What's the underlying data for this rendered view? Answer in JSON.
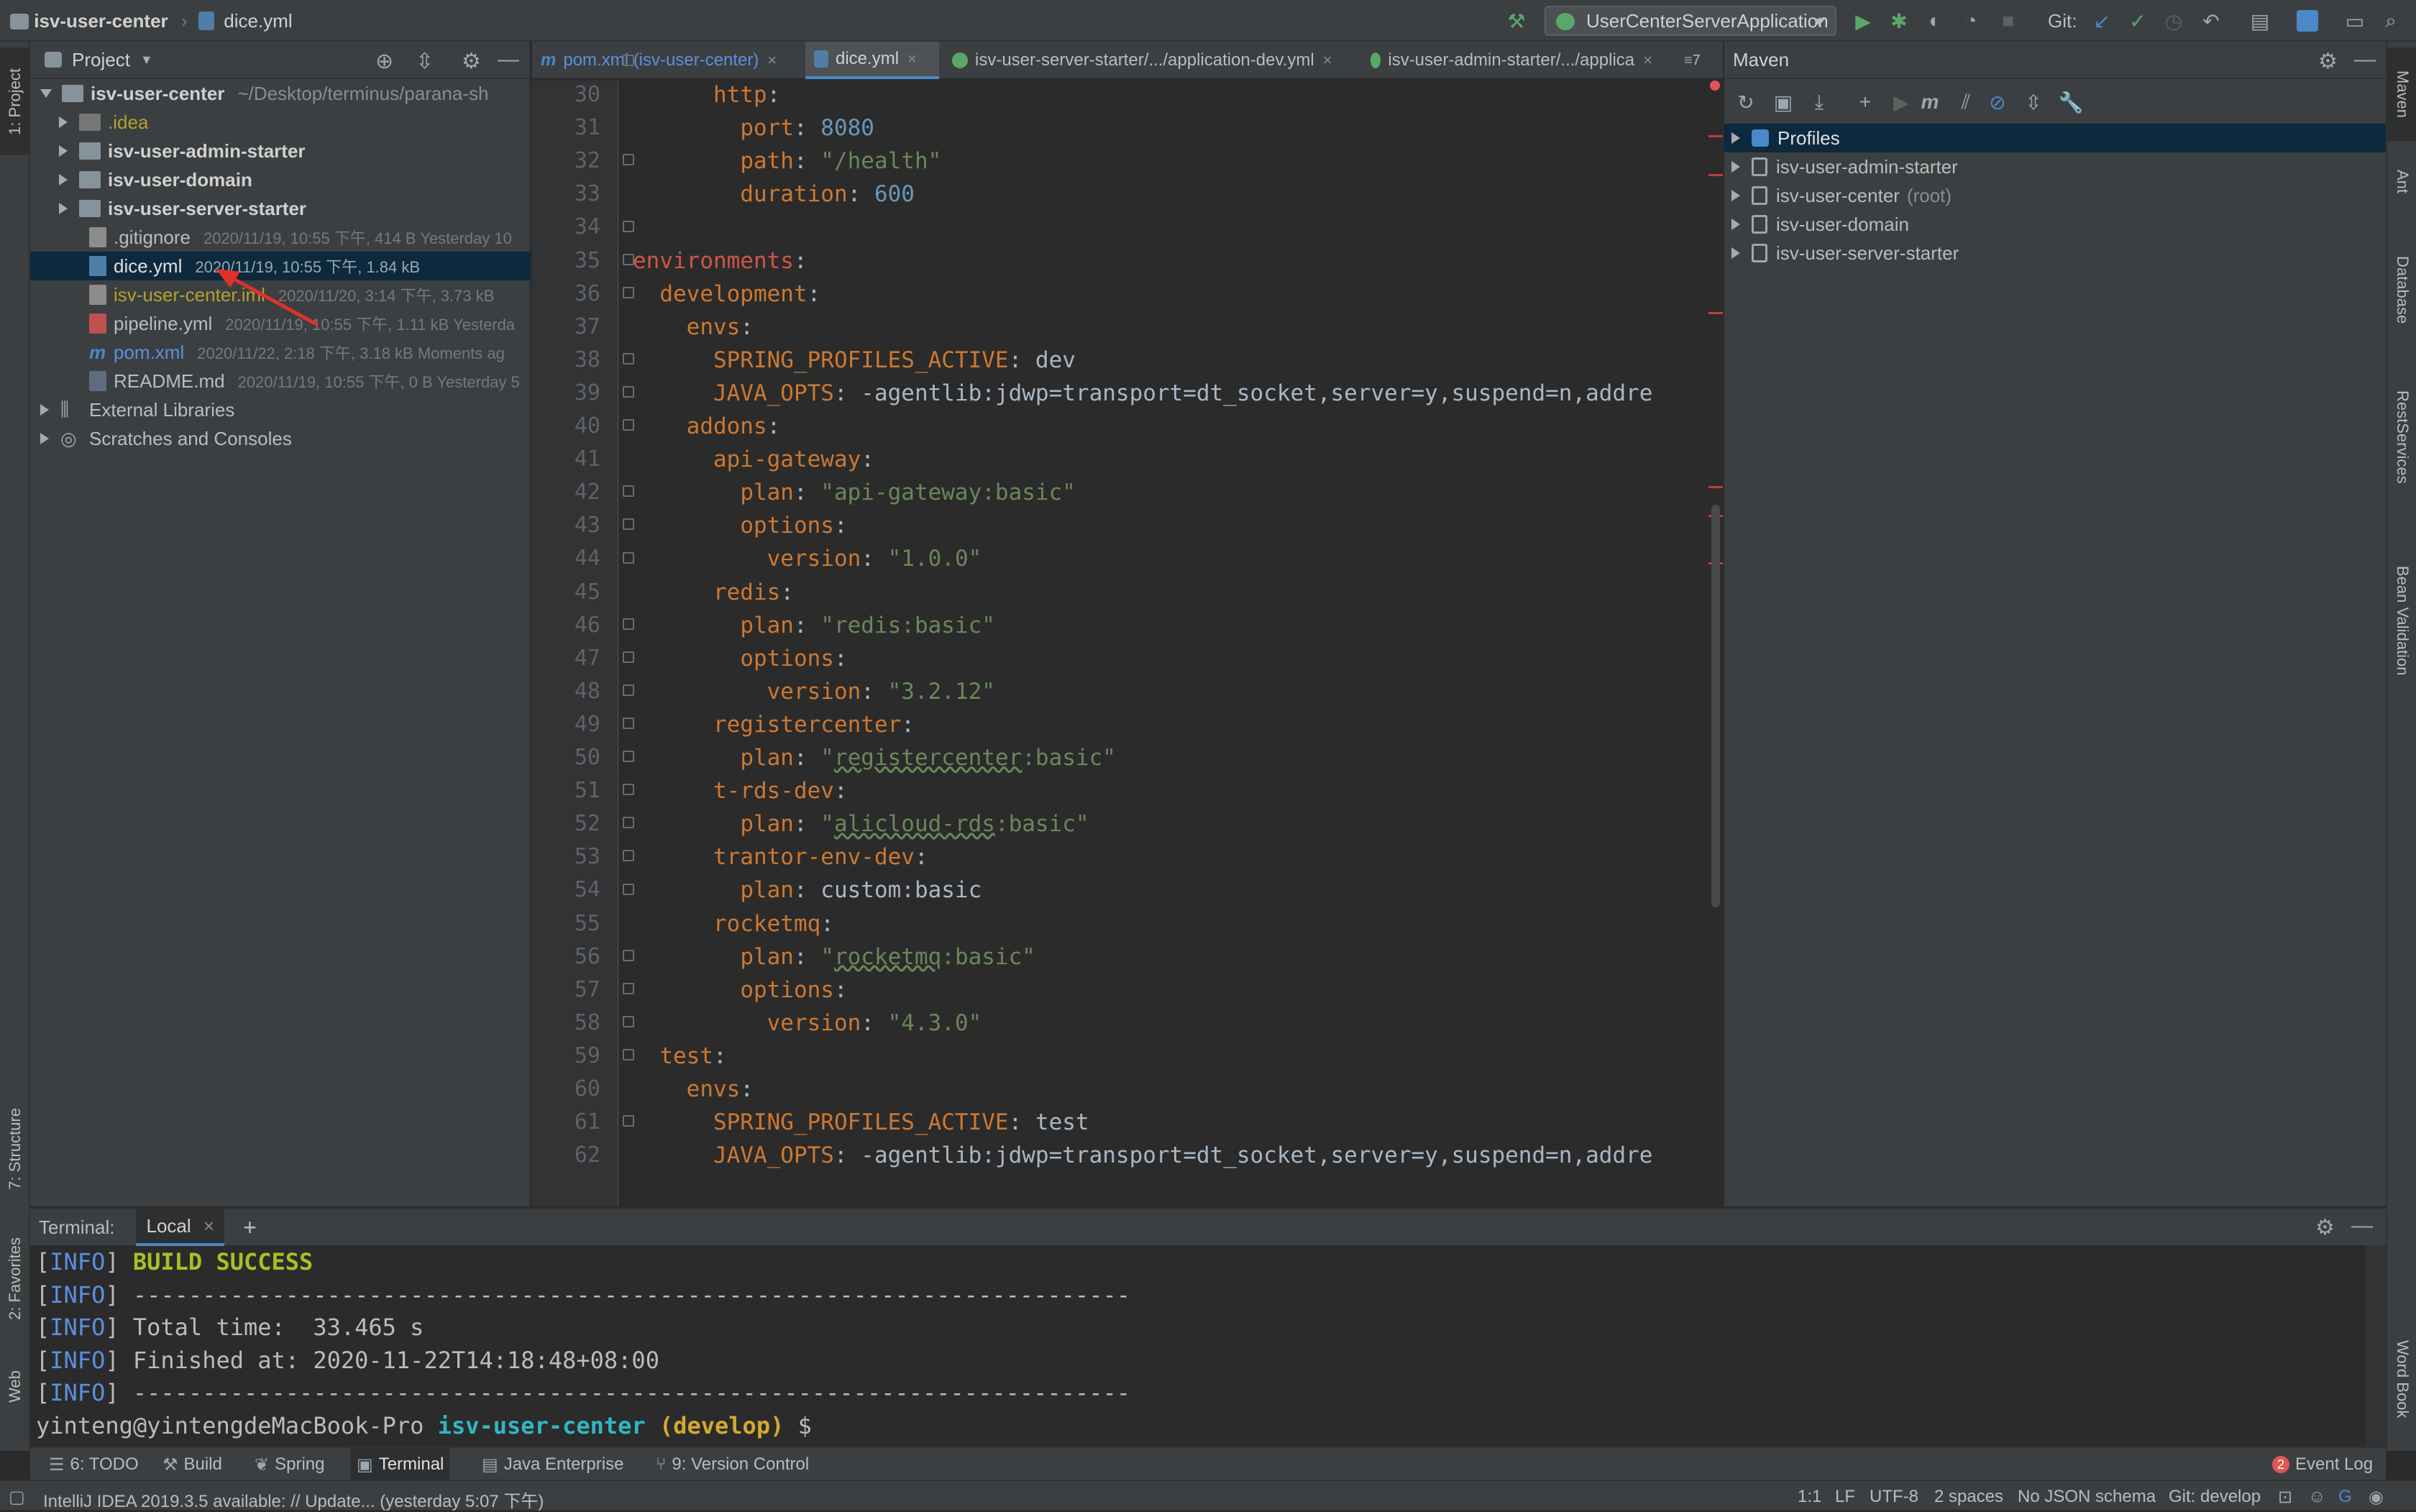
{
  "nav": {
    "project": "isv-user-center",
    "file": "dice.yml",
    "run_config": "UserCenterServerApplication",
    "git_label": "Git:"
  },
  "colors": {
    "accent": "#4a88c7",
    "selection": "#0d293e",
    "build_success": "#a8c023",
    "info": "#5c8fe0",
    "error_badge": "#e05555"
  },
  "left_stripe": {
    "project": "1: Project",
    "structure": "7: Structure",
    "favorites": "2: Favorites",
    "web": "Web"
  },
  "right_stripe": {
    "maven": "Maven",
    "ant": "Ant",
    "database": "Database",
    "rest": "RestServices",
    "bean": "Bean Validation",
    "word": "Word Book"
  },
  "project_panel": {
    "title": "Project",
    "root_name": "isv-user-center",
    "root_path": "~/Desktop/terminus/parana-sh",
    "items": [
      {
        "name": ".idea",
        "meta": ""
      },
      {
        "name": "isv-user-admin-starter",
        "meta": ""
      },
      {
        "name": "isv-user-domain",
        "meta": ""
      },
      {
        "name": "isv-user-server-starter",
        "meta": ""
      },
      {
        "name": ".gitignore",
        "meta": "2020/11/19, 10:55 下午, 414 B Yesterday 10"
      },
      {
        "name": "dice.yml",
        "meta": "2020/11/19, 10:55 下午, 1.84 kB"
      },
      {
        "name": "isv-user-center.iml",
        "meta": "2020/11/20, 3:14 下午, 3.73 kB"
      },
      {
        "name": "pipeline.yml",
        "meta": "2020/11/19, 10:55 下午, 1.11 kB Yesterda"
      },
      {
        "name": "pom.xml",
        "meta": "2020/11/22, 2:18 下午, 3.18 kB Moments ag"
      },
      {
        "name": "README.md",
        "meta": "2020/11/19, 10:55 下午, 0 B Yesterday 5"
      }
    ],
    "external": "External Libraries",
    "scratches": "Scratches and Consoles"
  },
  "editor": {
    "tabs": [
      {
        "label": "pom.xml (isv-user-center)"
      },
      {
        "label": "dice.yml"
      },
      {
        "label": "isv-user-server-starter/.../application-dev.yml"
      },
      {
        "label": "isv-user-admin-starter/.../applica"
      }
    ],
    "tab_overflow": "7",
    "line_numbers": [
      "30",
      "31",
      "32",
      "33",
      "34",
      "35",
      "36",
      "37",
      "38",
      "39",
      "40",
      "41",
      "42",
      "43",
      "44",
      "45",
      "46",
      "47",
      "48",
      "49",
      "50",
      "51",
      "52",
      "53",
      "54",
      "55",
      "56",
      "57",
      "58",
      "59",
      "60",
      "61",
      "62"
    ],
    "lines": [
      {
        "indent": "      ",
        "key": "http",
        "sep": ":",
        "val": "",
        "vtype": ""
      },
      {
        "indent": "        ",
        "key": "port",
        "sep": ": ",
        "val": "8080",
        "vtype": "n"
      },
      {
        "indent": "        ",
        "key": "path",
        "sep": ": ",
        "val": "\"/health\"",
        "vtype": "s"
      },
      {
        "indent": "        ",
        "key": "duration",
        "sep": ": ",
        "val": "600",
        "vtype": "n"
      },
      {
        "indent": "",
        "key": "",
        "sep": "",
        "val": "",
        "vtype": ""
      },
      {
        "indent": "",
        "key": "environments",
        "sep": ":",
        "val": "",
        "vtype": "",
        "ktype": "r"
      },
      {
        "indent": "  ",
        "key": "development",
        "sep": ":",
        "val": "",
        "vtype": ""
      },
      {
        "indent": "    ",
        "key": "envs",
        "sep": ":",
        "val": "",
        "vtype": ""
      },
      {
        "indent": "      ",
        "key": "SPRING_PROFILES_ACTIVE",
        "sep": ": ",
        "val": "dev",
        "vtype": "v"
      },
      {
        "indent": "      ",
        "key": "JAVA_OPTS",
        "sep": ": ",
        "val": "-agentlib:jdwp=transport=dt_socket,server=y,suspend=n,addre",
        "vtype": "v"
      },
      {
        "indent": "    ",
        "key": "addons",
        "sep": ":",
        "val": "",
        "vtype": ""
      },
      {
        "indent": "      ",
        "key": "api-gateway",
        "sep": ":",
        "val": "",
        "vtype": ""
      },
      {
        "indent": "        ",
        "key": "plan",
        "sep": ": ",
        "val": "\"api-gateway:basic\"",
        "vtype": "s"
      },
      {
        "indent": "        ",
        "key": "options",
        "sep": ":",
        "val": "",
        "vtype": ""
      },
      {
        "indent": "          ",
        "key": "version",
        "sep": ": ",
        "val": "\"1.0.0\"",
        "vtype": "s"
      },
      {
        "indent": "      ",
        "key": "redis",
        "sep": ":",
        "val": "",
        "vtype": ""
      },
      {
        "indent": "        ",
        "key": "plan",
        "sep": ": ",
        "val": "\"redis:basic\"",
        "vtype": "s"
      },
      {
        "indent": "        ",
        "key": "options",
        "sep": ":",
        "val": "",
        "vtype": ""
      },
      {
        "indent": "          ",
        "key": "version",
        "sep": ": ",
        "val": "\"3.2.12\"",
        "vtype": "s"
      },
      {
        "indent": "      ",
        "key": "registercenter",
        "sep": ":",
        "val": "",
        "vtype": ""
      },
      {
        "indent": "        ",
        "key": "plan",
        "sep": ": ",
        "val": "\"registercenter:basic\"",
        "vtype": "s"
      },
      {
        "indent": "      ",
        "key": "t-rds-dev",
        "sep": ":",
        "val": "",
        "vtype": ""
      },
      {
        "indent": "        ",
        "key": "plan",
        "sep": ": ",
        "val": "\"alicloud-rds:basic\"",
        "vtype": "s"
      },
      {
        "indent": "      ",
        "key": "trantor-env-dev",
        "sep": ":",
        "val": "",
        "vtype": ""
      },
      {
        "indent": "        ",
        "key": "plan",
        "sep": ": ",
        "val": "custom:basic",
        "vtype": "v"
      },
      {
        "indent": "      ",
        "key": "rocketmq",
        "sep": ":",
        "val": "",
        "vtype": ""
      },
      {
        "indent": "        ",
        "key": "plan",
        "sep": ": ",
        "val": "\"rocketmq:basic\"",
        "vtype": "s"
      },
      {
        "indent": "        ",
        "key": "options",
        "sep": ":",
        "val": "",
        "vtype": ""
      },
      {
        "indent": "          ",
        "key": "version",
        "sep": ": ",
        "val": "\"4.3.0\"",
        "vtype": "s"
      },
      {
        "indent": "  ",
        "key": "test",
        "sep": ":",
        "val": "",
        "vtype": ""
      },
      {
        "indent": "    ",
        "key": "envs",
        "sep": ":",
        "val": "",
        "vtype": ""
      },
      {
        "indent": "      ",
        "key": "SPRING_PROFILES_ACTIVE",
        "sep": ": ",
        "val": "test",
        "vtype": "v"
      },
      {
        "indent": "      ",
        "key": "JAVA_OPTS",
        "sep": ": ",
        "val": "-agentlib:jdwp=transport=dt_socket,server=y,suspend=n,addre",
        "vtype": "v"
      }
    ]
  },
  "maven": {
    "title": "Maven",
    "items": [
      {
        "name": "Profiles",
        "suffix": ""
      },
      {
        "name": "isv-user-admin-starter",
        "suffix": ""
      },
      {
        "name": "isv-user-center",
        "suffix": "(root)"
      },
      {
        "name": "isv-user-domain",
        "suffix": ""
      },
      {
        "name": "isv-user-server-starter",
        "suffix": ""
      }
    ]
  },
  "terminal": {
    "title": "Terminal:",
    "tab": "Local",
    "lines": [
      {
        "tag": "[INFO]",
        "text": " ",
        "hl": "BUILD SUCCESS"
      },
      {
        "tag": "[INFO]",
        "text": " ------------------------------------------------------------------------",
        "hl": ""
      },
      {
        "tag": "[INFO]",
        "text": " Total time:  33.465 s",
        "hl": ""
      },
      {
        "tag": "[INFO]",
        "text": " Finished at: 2020-11-22T14:18:48+08:00",
        "hl": ""
      },
      {
        "tag": "[INFO]",
        "text": " ------------------------------------------------------------------------",
        "hl": ""
      }
    ],
    "prompt_user": "yinteng@yintengdeMacBook-Pro",
    "prompt_dir": "isv-user-center",
    "prompt_branch": "(develop)",
    "prompt_symbol": "$"
  },
  "toolwindows": {
    "todo": "6: TODO",
    "build": "Build",
    "spring": "Spring",
    "terminal": "Terminal",
    "java_ee": "Java Enterprise",
    "vcs": "9: Version Control",
    "event_log": "Event Log",
    "event_count": "2"
  },
  "status": {
    "message": "IntelliJ IDEA 2019.3.5 available: // Update... (yesterday 5:07 下午)",
    "position": "1:1",
    "line_sep": "LF",
    "encoding": "UTF-8",
    "indent": "2 spaces",
    "schema": "No JSON schema",
    "git": "Git: develop"
  }
}
